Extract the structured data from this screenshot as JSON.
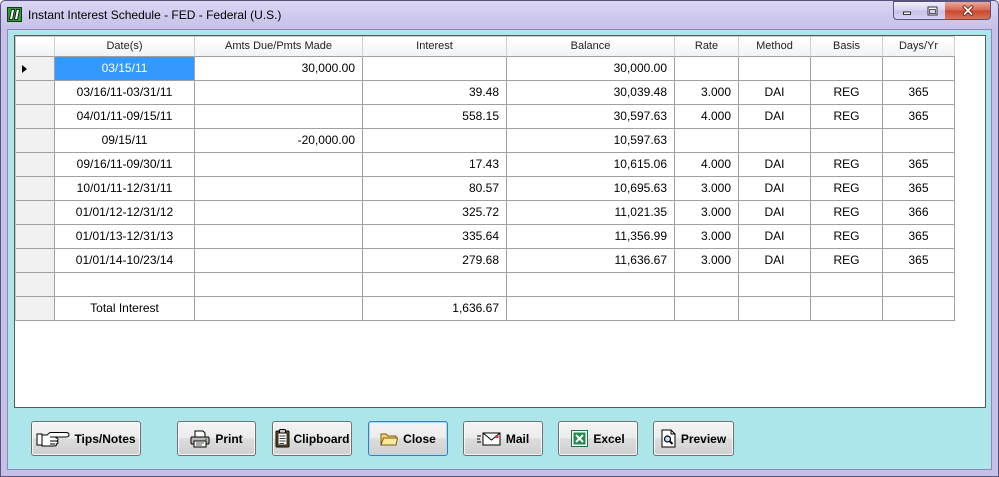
{
  "window": {
    "title": "Instant Interest Schedule - FED - Federal (U.S.)",
    "icon": "app-logo-icon",
    "controls": {
      "minimize": "minimize-icon",
      "maximize": "maximize-icon",
      "close": "close-icon"
    }
  },
  "grid": {
    "columns": {
      "dates": "Date(s)",
      "amount": "Amts Due/Pmts Made",
      "interest": "Interest",
      "balance": "Balance",
      "rate": "Rate",
      "method": "Method",
      "basis": "Basis",
      "days": "Days/Yr"
    },
    "current_row": 0,
    "selected_cell": {
      "row": 0,
      "column": "dates"
    },
    "rows": [
      {
        "dates": "03/15/11",
        "amount": "30,000.00",
        "balance": "30,000.00"
      },
      {
        "dates": "03/16/11-03/31/11",
        "interest": "39.48",
        "balance": "30,039.48",
        "rate": "3.000",
        "method": "DAI",
        "basis": "REG",
        "days": "365"
      },
      {
        "dates": "04/01/11-09/15/11",
        "interest": "558.15",
        "balance": "30,597.63",
        "rate": "4.000",
        "method": "DAI",
        "basis": "REG",
        "days": "365"
      },
      {
        "dates": "09/15/11",
        "amount": "-20,000.00",
        "balance": "10,597.63"
      },
      {
        "dates": "09/16/11-09/30/11",
        "interest": "17.43",
        "balance": "10,615.06",
        "rate": "4.000",
        "method": "DAI",
        "basis": "REG",
        "days": "365"
      },
      {
        "dates": "10/01/11-12/31/11",
        "interest": "80.57",
        "balance": "10,695.63",
        "rate": "3.000",
        "method": "DAI",
        "basis": "REG",
        "days": "365"
      },
      {
        "dates": "01/01/12-12/31/12",
        "interest": "325.72",
        "balance": "11,021.35",
        "rate": "3.000",
        "method": "DAI",
        "basis": "REG",
        "days": "366"
      },
      {
        "dates": "01/01/13-12/31/13",
        "interest": "335.64",
        "balance": "11,356.99",
        "rate": "3.000",
        "method": "DAI",
        "basis": "REG",
        "days": "365"
      },
      {
        "dates": "01/01/14-10/23/14",
        "interest": "279.68",
        "balance": "11,636.67",
        "rate": "3.000",
        "method": "DAI",
        "basis": "REG",
        "days": "365"
      }
    ],
    "total": {
      "label": "Total Interest",
      "interest": "1,636.67"
    }
  },
  "buttons": {
    "tips_notes": {
      "label": "Tips/Notes",
      "icon": "pointing-hand-icon"
    },
    "print": {
      "label": "Print",
      "icon": "printer-icon"
    },
    "clipboard": {
      "label": "Clipboard",
      "icon": "clipboard-icon"
    },
    "close": {
      "label": "Close",
      "icon": "folder-icon",
      "focused": true
    },
    "mail": {
      "label": "Mail",
      "icon": "envelope-icon"
    },
    "excel": {
      "label": "Excel",
      "icon": "excel-icon"
    },
    "preview": {
      "label": "Preview",
      "icon": "print-preview-icon"
    }
  },
  "colors": {
    "frame": "#c6bfe8",
    "client_background": "#ade6ea",
    "selection": "#3399ff",
    "grid_lines": "#a0a0a0",
    "close_button": "#c7472d",
    "focus_border": "#3c7fb1"
  }
}
